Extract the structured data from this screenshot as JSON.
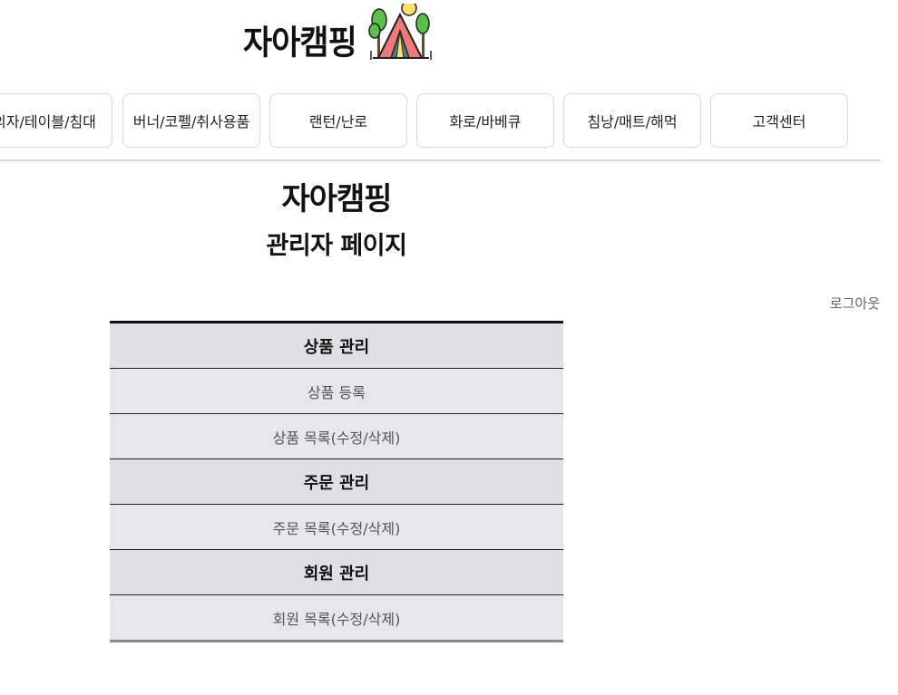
{
  "brand": {
    "name": "자아캠핑",
    "logo_icon": "tent-with-trees-and-sun-icon"
  },
  "nav": {
    "items": [
      {
        "label": "의자/테이블/침대"
      },
      {
        "label": "버너/코펠/취사용품"
      },
      {
        "label": "랜턴/난로"
      },
      {
        "label": "화로/바베큐"
      },
      {
        "label": "침낭/매트/해먹"
      },
      {
        "label": "고객센터"
      }
    ]
  },
  "admin": {
    "title": "자아캠핑",
    "subtitle": "관리자 페이지",
    "logout_label": "로그아웃"
  },
  "menu": {
    "product_header": "상품 관리",
    "product_register": "상품 등록",
    "product_list": "상품 목록(수정/삭제)",
    "order_header": "주문 관리",
    "order_list": "주문 목록(수정/삭제)",
    "member_header": "회원 관리",
    "member_list": "회원 목록(수정/삭제)"
  },
  "colors": {
    "header_row_bg": "#dfe0e5",
    "item_row_bg": "#e6e7ee",
    "tent": "#f07a78",
    "tree": "#5cbf4a",
    "sun": "#f7e26b"
  }
}
